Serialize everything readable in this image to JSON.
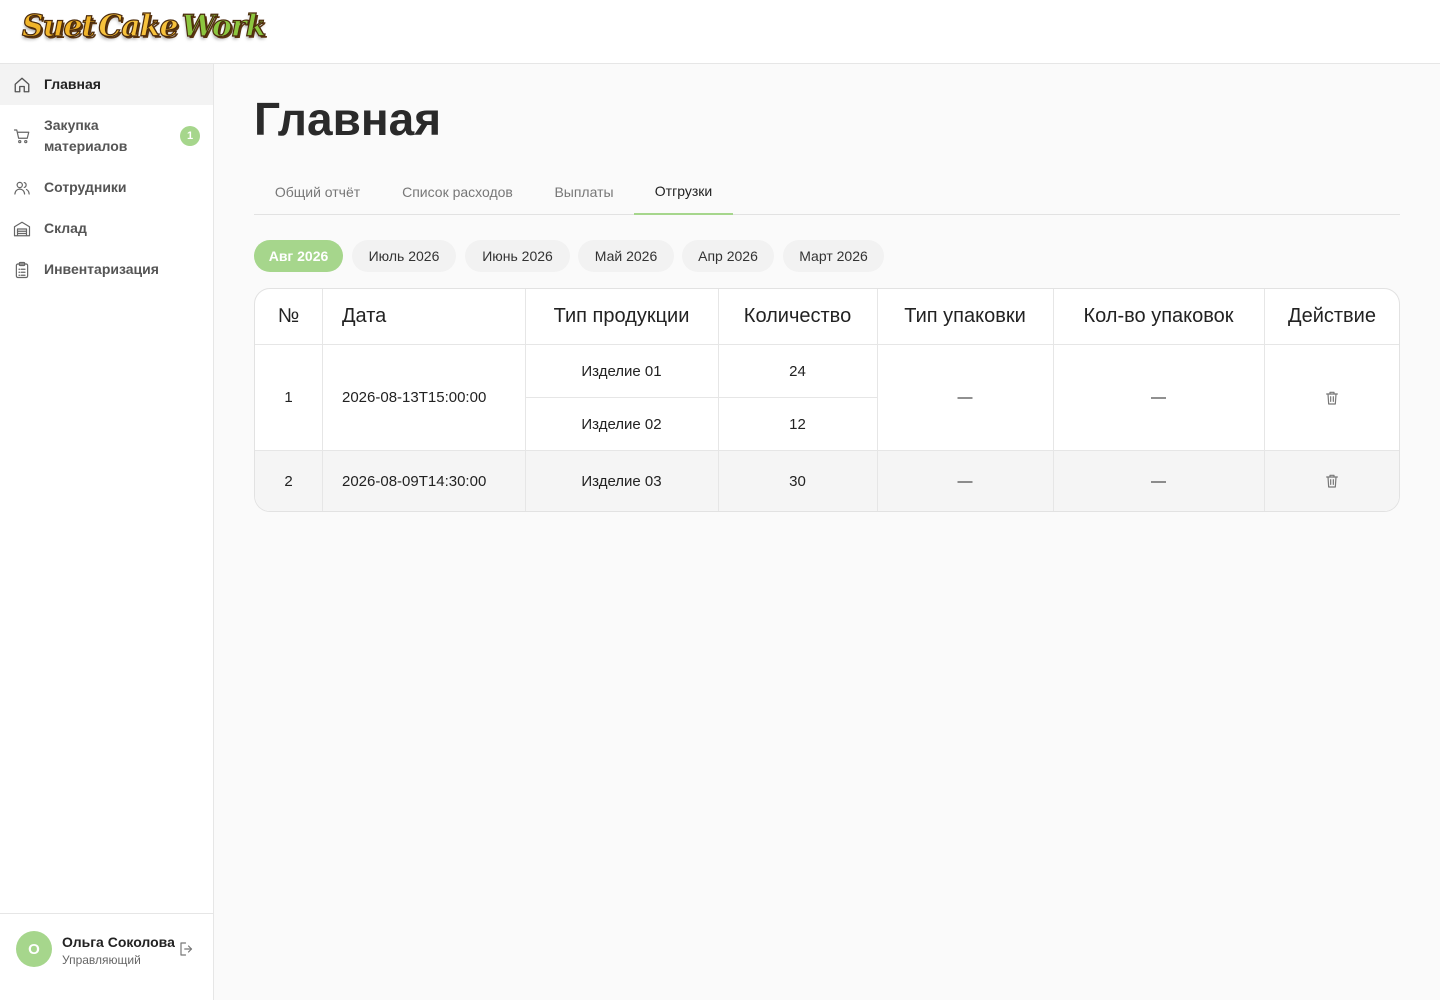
{
  "app": {
    "logo_words": [
      "Suet",
      "Cake",
      "Work"
    ]
  },
  "sidebar": {
    "items": [
      {
        "label": "Главная",
        "icon": "home-icon",
        "active": true
      },
      {
        "label": "Закупка материалов",
        "label_line1": "Закупка",
        "label_line2": "материалов",
        "icon": "cart-icon",
        "badge": "1"
      },
      {
        "label": "Сотрудники",
        "icon": "users-icon"
      },
      {
        "label": "Склад",
        "icon": "warehouse-icon"
      },
      {
        "label": "Инвентаризация",
        "icon": "clipboard-icon"
      }
    ],
    "user": {
      "initial": "О",
      "name": "Ольга Соколова",
      "role": "Управляющий"
    }
  },
  "main": {
    "title": "Главная",
    "tabs": [
      {
        "label": "Общий отчёт"
      },
      {
        "label": "Список расходов"
      },
      {
        "label": "Выплаты"
      },
      {
        "label": "Отгрузки",
        "active": true
      }
    ],
    "months": [
      {
        "label": "Авг 2026",
        "active": true
      },
      {
        "label": "Июль 2026"
      },
      {
        "label": "Июнь 2026"
      },
      {
        "label": "Май 2026"
      },
      {
        "label": "Апр 2026"
      },
      {
        "label": "Март 2026"
      }
    ],
    "table": {
      "headers": [
        "№",
        "Дата",
        "Тип продукции",
        "Количество",
        "Тип упаковки",
        "Кол-во упаковок",
        "Действие"
      ],
      "rows": [
        {
          "num": "1",
          "date": "2026-08-13T15:00:00",
          "products": [
            {
              "type": "Изделие 01",
              "qty": "24"
            },
            {
              "type": "Изделие 02",
              "qty": "12"
            }
          ],
          "pack_type": "—",
          "pack_count": "—"
        },
        {
          "num": "2",
          "date": "2026-08-09T14:30:00",
          "products": [
            {
              "type": "Изделие 03",
              "qty": "30"
            }
          ],
          "pack_type": "—",
          "pack_count": "—"
        }
      ]
    }
  },
  "colors": {
    "accent": "#a6d68c",
    "text": "#222222",
    "muted": "#777777"
  }
}
